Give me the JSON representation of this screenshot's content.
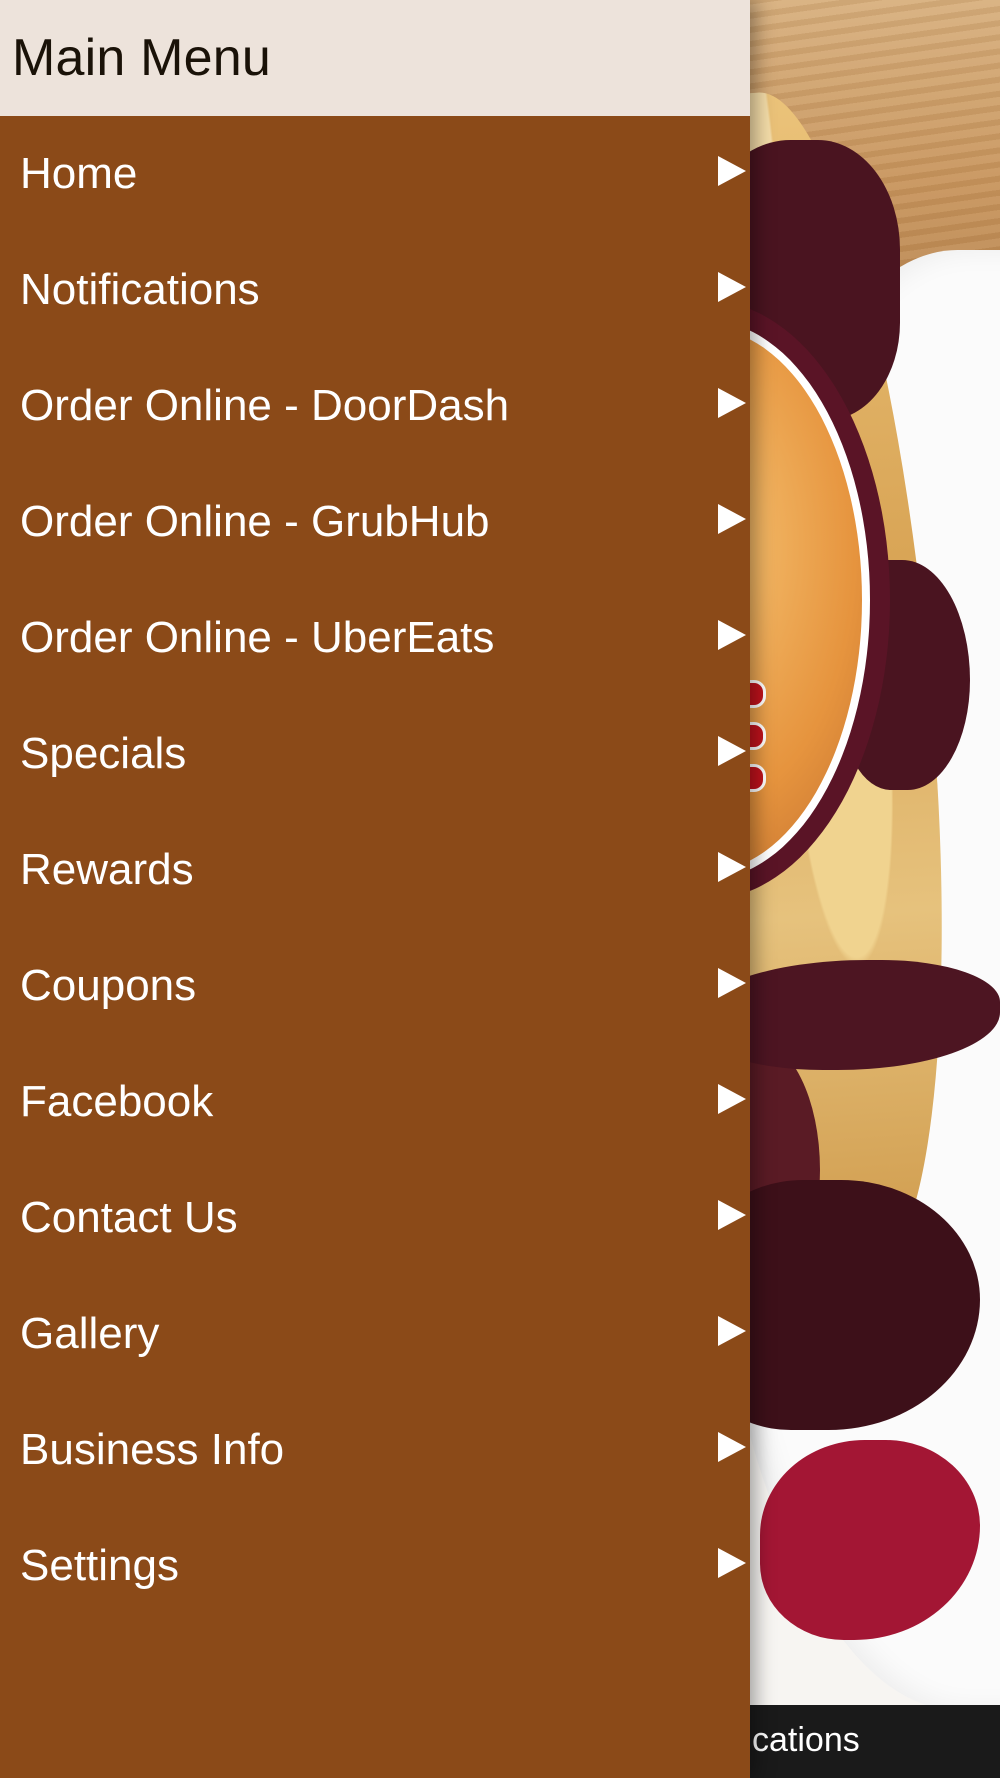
{
  "drawer": {
    "title": "Main Menu",
    "items": [
      {
        "label": "Home"
      },
      {
        "label": "Notifications"
      },
      {
        "label": "Order Online - DoorDash"
      },
      {
        "label": "Order Online - GrubHub"
      },
      {
        "label": "Order Online - UberEats"
      },
      {
        "label": "Specials"
      },
      {
        "label": "Rewards"
      },
      {
        "label": "Coupons"
      },
      {
        "label": "Facebook"
      },
      {
        "label": "Contact Us"
      },
      {
        "label": "Gallery"
      },
      {
        "label": "Business Info"
      },
      {
        "label": "Settings"
      }
    ],
    "arrow_icon": "play-right-icon"
  },
  "bottom_bar": {
    "visible_label": "fications"
  },
  "colors": {
    "drawer_bg": "#8b4a18",
    "header_bg": "#ede3db",
    "menu_text": "#ffffff",
    "title_text": "#1a1208",
    "bottom_bar_bg": "#1a1a1a"
  }
}
